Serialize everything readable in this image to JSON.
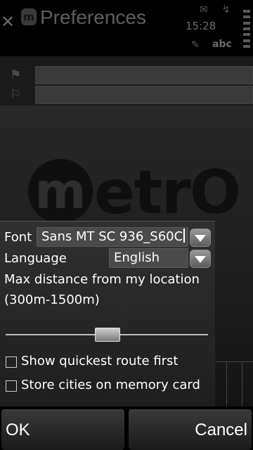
{
  "titlebar": {
    "title": "Preferences",
    "time": "15:28",
    "input_mode": "abc",
    "icons": [
      "close-icon",
      "app-icon",
      "mail-icon",
      "signal-icon",
      "pen-input-icon",
      "battery-icon"
    ]
  },
  "background_app": {
    "logo_letter": "m",
    "logo_text": "etrO",
    "fields": [
      "start-flag",
      "end-flag"
    ]
  },
  "dialog": {
    "font_label": "Font",
    "font_value": "Sans MT SC 936_S60C",
    "language_label": "Language",
    "language_value": "English",
    "distance_label_line1": "Max distance from my location",
    "distance_label_line2": "(300m-1500m)",
    "slider_value_fraction": 0.5,
    "checkbox_quickest": {
      "label": "Show quickest route first",
      "checked": false
    },
    "checkbox_store": {
      "label": "Store cities on memory card",
      "checked": false
    }
  },
  "softkeys": {
    "left": "OK",
    "right": "Cancel"
  }
}
